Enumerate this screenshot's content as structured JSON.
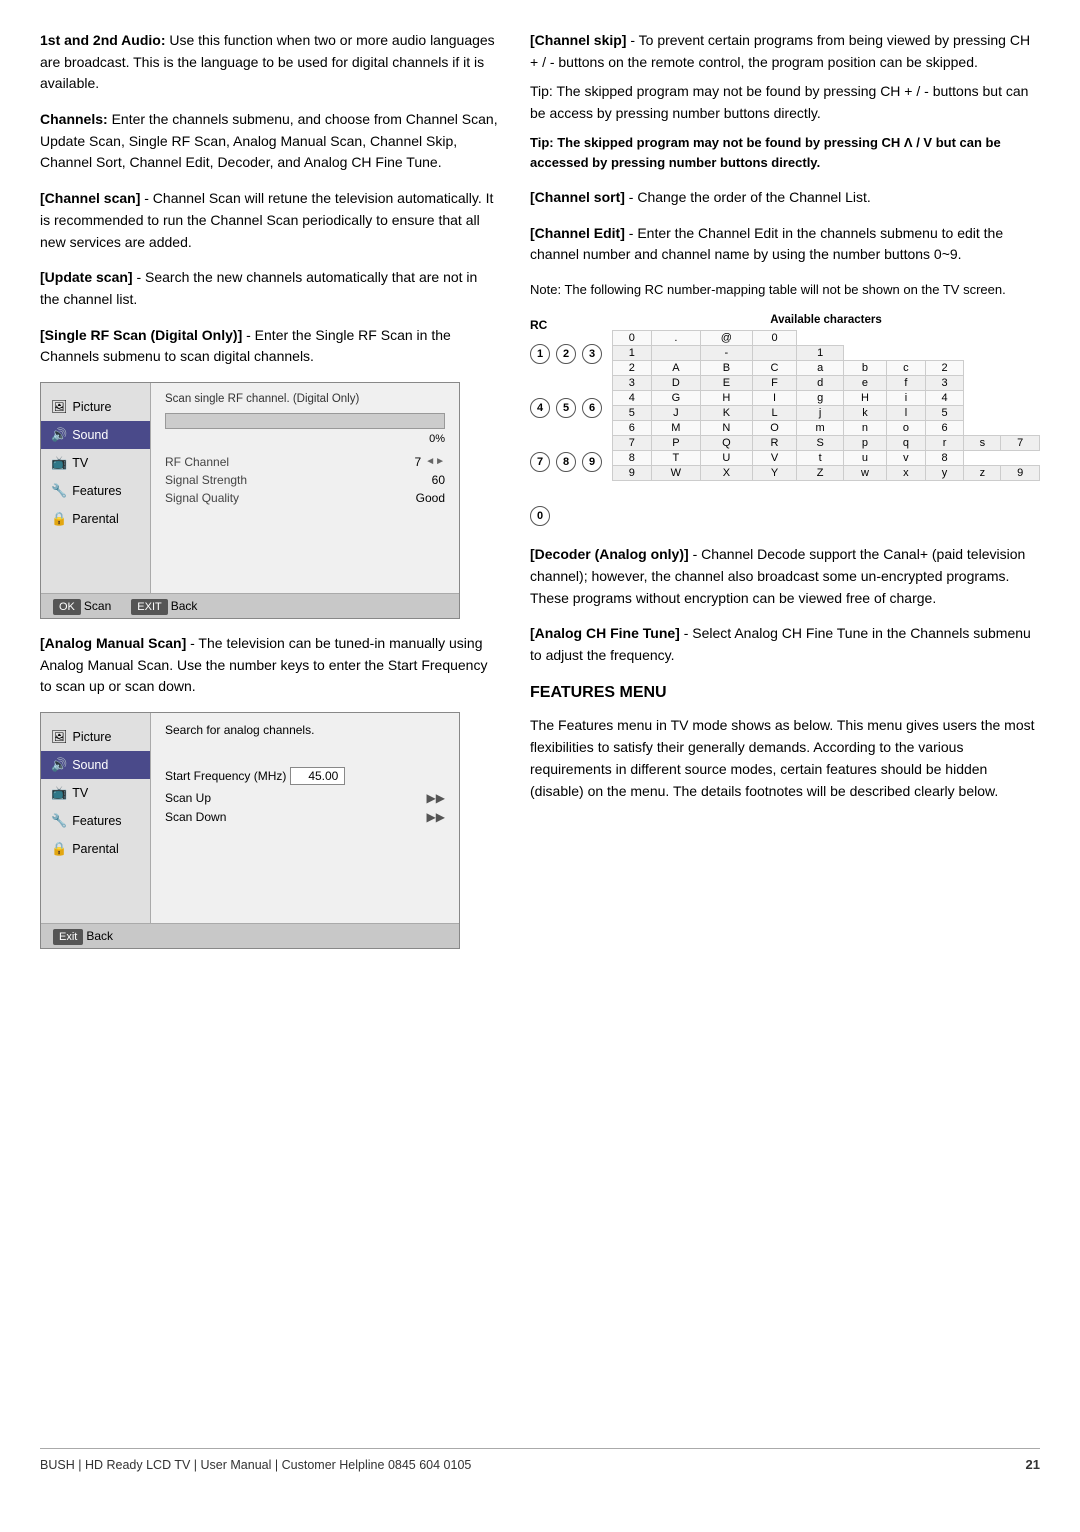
{
  "page": {
    "footer": {
      "brand": "BUSH",
      "product": "HD Ready LCD TV",
      "manual": "User Manual",
      "helpline_label": "Customer Helpline",
      "helpline_number": "0845 604 0105",
      "page_number": "21"
    }
  },
  "left": {
    "item3_heading": "1st and 2nd Audio:",
    "item3_text": "Use this function when two or more audio languages are broadcast. This is the language to be used for digital channels if it is available.",
    "item4_heading": "Channels:",
    "item4_text": "Enter the channels submenu, and choose from Channel Scan, Update Scan, Single RF Scan, Analog Manual Scan, Channel Skip, Channel Sort, Channel Edit, Decoder, and Analog CH Fine Tune.",
    "channel_scan_heading": "[Channel scan]",
    "channel_scan_text": "- Channel Scan will retune the television automatically. It is recommended to run the Channel Scan periodically to ensure that all new services are added.",
    "update_scan_heading": "[Update scan]",
    "update_scan_text": "- Search the new channels automatically that are not in the channel list.",
    "single_rf_heading": "[Single RF Scan (Digital Only)]",
    "single_rf_text": "- Enter the Single RF Scan in the Channels submenu to scan digital channels.",
    "menu1": {
      "items": [
        "Picture",
        "Sound",
        "TV",
        "Features",
        "Parental"
      ],
      "selected": "Sound",
      "scan_label": "Scan single RF channel. (Digital Only)",
      "progress_percent": "0%",
      "rf_channel_label": "RF Channel",
      "rf_channel_value": "7",
      "signal_strength_label": "Signal Strength",
      "signal_strength_value": "60",
      "signal_quality_label": "Signal Quality",
      "signal_quality_value": "Good",
      "ok_btn": "OK",
      "ok_action": "Scan",
      "exit_btn": "EXIT",
      "exit_action": "Back"
    },
    "analog_manual_heading": "[Analog Manual Scan]",
    "analog_manual_text": "- The television can be tuned-in manually using Analog Manual Scan. Use the number keys to enter the Start Frequency to scan up or scan down.",
    "menu2": {
      "items": [
        "Picture",
        "Sound",
        "TV",
        "Features",
        "Parental"
      ],
      "selected": "Sound",
      "search_label": "Search for analog channels.",
      "start_freq_label": "Start Frequency (MHz)",
      "start_freq_value": "45.00",
      "scan_up_label": "Scan Up",
      "scan_down_label": "Scan Down",
      "exit_btn": "Exit",
      "exit_action": "Back"
    }
  },
  "right": {
    "channel_skip_heading": "[Channel skip]",
    "channel_skip_text": "- To prevent certain programs from being viewed by pressing CH + / - buttons on the remote control, the program position can be skipped.",
    "tip1": "Tip: The skipped program may not be found by pressing CH + / - buttons but can be access by pressing number buttons directly.",
    "tip2_bold": "Tip: The skipped program may not be found by pressing CH Λ / V but can be accessed by pressing number buttons directly.",
    "channel_sort_heading": "[Channel sort]",
    "channel_sort_text": "- Change the order of the Channel List.",
    "channel_edit_heading": "[Channel Edit]",
    "channel_edit_text": "- Enter the Channel Edit in the channels submenu to edit the channel number and channel name by using the number buttons 0~9.",
    "note_text": "Note: The following RC number-mapping table will not be shown on the TV screen.",
    "rc_label": "RC",
    "avail_chars_label": "Available characters",
    "rc_rows": [
      {
        "buttons": [
          "1",
          "2",
          "3"
        ],
        "chars": [
          "0",
          ".",
          "@",
          "0"
        ]
      },
      {
        "buttons": [],
        "chars": [
          "1",
          "",
          "-",
          "",
          "1"
        ]
      },
      {
        "buttons": [
          "4",
          "5",
          "6"
        ],
        "chars": [
          "2",
          "A",
          "B",
          "C",
          "a",
          "b",
          "c",
          "2"
        ]
      },
      {
        "buttons": [],
        "chars": [
          "3",
          "D",
          "E",
          "F",
          "d",
          "e",
          "f",
          "3"
        ]
      },
      {
        "buttons": [
          "7",
          "8",
          "9"
        ],
        "chars": [
          "4",
          "G",
          "H",
          "I",
          "g",
          "H",
          "i",
          "4"
        ]
      },
      {
        "buttons": [],
        "chars": [
          "5",
          "J",
          "K",
          "L",
          "j",
          "k",
          "l",
          "5"
        ]
      },
      {
        "buttons": [
          "0"
        ],
        "chars": [
          "6",
          "M",
          "N",
          "O",
          "m",
          "n",
          "o",
          "6"
        ]
      },
      {
        "buttons": [],
        "chars": [
          "7",
          "P",
          "Q",
          "R",
          "S",
          "p",
          "q",
          "r",
          "s",
          "7"
        ]
      },
      {
        "buttons": [],
        "chars": [
          "8",
          "T",
          "U",
          "V",
          "t",
          "u",
          "v",
          "8"
        ]
      },
      {
        "buttons": [],
        "chars": [
          "9",
          "W",
          "X",
          "Y",
          "Z",
          "w",
          "x",
          "y",
          "z",
          "9"
        ]
      }
    ],
    "decoder_heading": "[Decoder (Analog only)]",
    "decoder_text": "- Channel Decode support the Canal+ (paid television channel); however, the channel also broadcast some un-encrypted programs. These programs without encryption can be viewed free of charge.",
    "analog_fine_heading": "[Analog CH Fine Tune]",
    "analog_fine_text": "- Select Analog CH Fine Tune in the Channels submenu to adjust the frequency.",
    "features_menu_heading": "FEATURES MENU",
    "features_menu_text": "The Features menu in TV mode shows as below. This menu gives users the most flexibilities to satisfy their generally demands. According to the various requirements in different source modes, certain features should be hidden (disable) on the menu. The details footnotes will be described clearly below."
  }
}
